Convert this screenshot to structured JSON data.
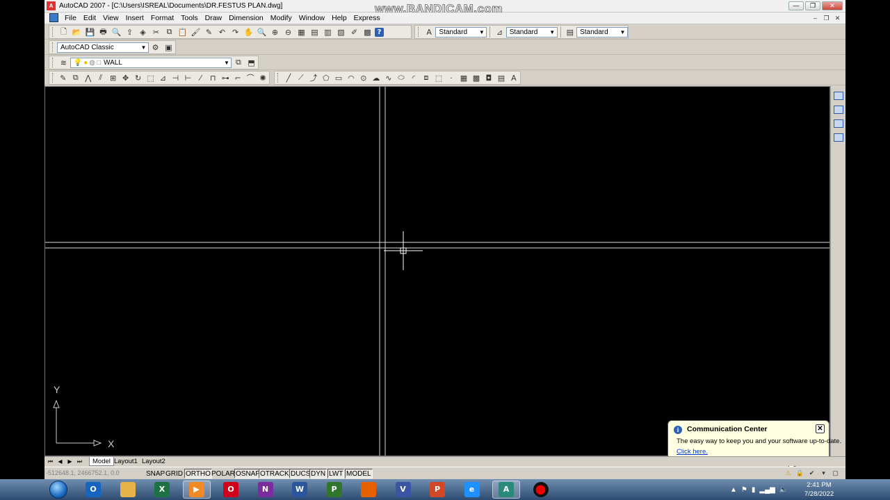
{
  "watermark": "www.BANDICAM.com",
  "window": {
    "title": "AutoCAD 2007 - [C:\\Users\\ISREAL\\Documents\\DR.FESTUS PLAN.dwg]",
    "app_icon": "autocad-icon",
    "controls": {
      "minimize": "—",
      "maximize": "❐",
      "close": "✕"
    }
  },
  "menubar": {
    "items": [
      "File",
      "Edit",
      "View",
      "Insert",
      "Format",
      "Tools",
      "Draw",
      "Dimension",
      "Modify",
      "Window",
      "Help",
      "Express"
    ],
    "doc_controls": {
      "minimize": "–",
      "restore": "❐",
      "close": "✕"
    }
  },
  "toolbars": {
    "standard_icons": [
      "new-icon",
      "open-icon",
      "save-icon",
      "plot-icon",
      "plot-preview-icon",
      "publish-icon",
      "3d-dwf-icon",
      "cut-icon",
      "copy-icon",
      "paste-icon",
      "match-properties-icon",
      "block-editor-icon",
      "undo-icon",
      "redo-icon",
      "pan-icon",
      "zoom-realtime-icon",
      "zoom-window-icon",
      "zoom-previous-icon",
      "properties-icon",
      "design-center-icon",
      "tool-palettes-icon",
      "sheet-set-icon",
      "markup-icon",
      "quickcalc-icon",
      "help-icon"
    ],
    "text_style": "Standard",
    "dim_style": "Standard",
    "table_style": "Standard",
    "workspace": "AutoCAD Classic",
    "layer": "WALL",
    "modify_icons": [
      "erase-icon",
      "copy-object-icon",
      "mirror-icon",
      "offset-icon",
      "array-icon",
      "move-icon",
      "rotate-icon",
      "scale-icon",
      "stretch-icon",
      "trim-icon",
      "extend-icon",
      "break-at-point-icon",
      "break-icon",
      "join-icon",
      "chamfer-icon",
      "fillet-icon",
      "explode-icon"
    ],
    "draw_icons": [
      "line-icon",
      "construction-line-icon",
      "polyline-icon",
      "polygon-icon",
      "rectangle-icon",
      "arc-icon",
      "circle-icon",
      "revision-cloud-icon",
      "spline-icon",
      "ellipse-icon",
      "ellipse-arc-icon",
      "insert-block-icon",
      "make-block-icon",
      "point-icon",
      "hatch-icon",
      "gradient-icon",
      "region-icon",
      "table-icon",
      "multiline-text-icon"
    ]
  },
  "ucs": {
    "y_label": "Y",
    "x_label": "X"
  },
  "layout_tabs": [
    "Model",
    "Layout1",
    "Layout2"
  ],
  "status": {
    "coordinates": "-512648.1, 2466752.1, 0.0",
    "buttons": [
      {
        "label": "SNAP",
        "on": false
      },
      {
        "label": "GRID",
        "on": false
      },
      {
        "label": "ORTHO",
        "on": true
      },
      {
        "label": "POLAR",
        "on": false
      },
      {
        "label": "OSNAP",
        "on": true
      },
      {
        "label": "OTRACK",
        "on": true
      },
      {
        "label": "DUCS",
        "on": true
      },
      {
        "label": "DYN",
        "on": true
      },
      {
        "label": "LWT",
        "on": true
      },
      {
        "label": "MODEL",
        "on": true
      }
    ]
  },
  "communication_center": {
    "title": "Communication Center",
    "message": "The easy way to keep you and your software up-to-date.",
    "link": "Click here."
  },
  "taskbar": {
    "apps": [
      {
        "name": "outlook",
        "letter": "O",
        "color": "#1565c0"
      },
      {
        "name": "explorer",
        "letter": "",
        "color": "#e6b34a"
      },
      {
        "name": "excel",
        "letter": "X",
        "color": "#1e7145"
      },
      {
        "name": "media-player",
        "letter": "▶",
        "color": "#f08a24"
      },
      {
        "name": "opera",
        "letter": "O",
        "color": "#d0021b"
      },
      {
        "name": "onenote",
        "letter": "N",
        "color": "#7b2d9e"
      },
      {
        "name": "word",
        "letter": "W",
        "color": "#2b579a"
      },
      {
        "name": "project",
        "letter": "P",
        "color": "#31752f"
      },
      {
        "name": "firefox",
        "letter": "",
        "color": "#e66000"
      },
      {
        "name": "visio",
        "letter": "V",
        "color": "#3955a3"
      },
      {
        "name": "powerpoint",
        "letter": "P",
        "color": "#d24726"
      },
      {
        "name": "internet-explorer",
        "letter": "e",
        "color": "#1e90ff"
      },
      {
        "name": "autocad",
        "letter": "A",
        "color": "#2a8a7a"
      },
      {
        "name": "bandicam",
        "letter": "●",
        "color": "#111111"
      }
    ],
    "time": "2:41 PM",
    "date": "7/28/2022"
  }
}
